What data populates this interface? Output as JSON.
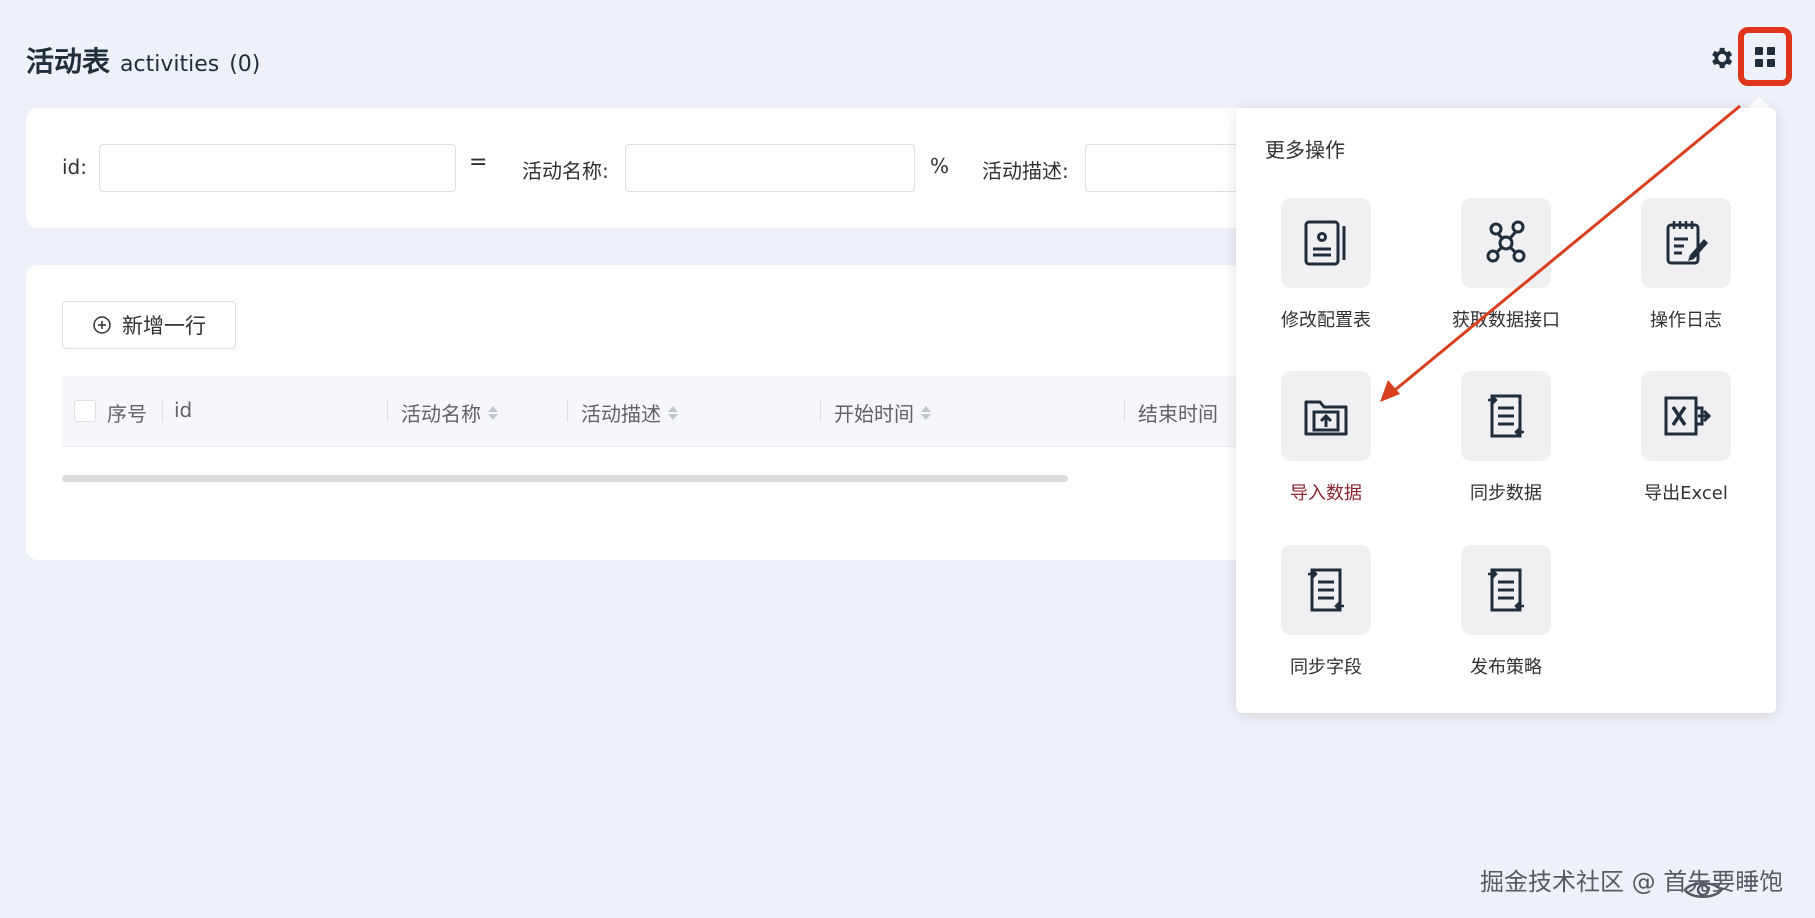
{
  "header": {
    "title": "活动表",
    "subtitle": "activities",
    "count": "(0)"
  },
  "filters": {
    "id_label": "id:",
    "id_operator": "=",
    "name_label": "活动名称:",
    "name_operator": "%",
    "desc_label": "活动描述:"
  },
  "toolbar": {
    "add_row_label": "新增一行"
  },
  "table": {
    "columns": [
      "序号",
      "id",
      "活动名称",
      "活动描述",
      "开始时间",
      "结束时间"
    ]
  },
  "popover": {
    "title": "更多操作",
    "items": [
      {
        "label": "修改配置表",
        "icon": "config-document-icon"
      },
      {
        "label": "获取数据接口",
        "icon": "network-nodes-icon"
      },
      {
        "label": "操作日志",
        "icon": "edit-log-icon"
      },
      {
        "label": "导入数据",
        "icon": "folder-upload-icon",
        "active": true
      },
      {
        "label": "同步数据",
        "icon": "sync-list-icon"
      },
      {
        "label": "导出Excel",
        "icon": "excel-export-icon"
      },
      {
        "label": "同步字段",
        "icon": "sync-list-icon"
      },
      {
        "label": "发布策略",
        "icon": "sync-list-icon"
      }
    ]
  },
  "watermark": "掘金技术社区 @ 首先要睡饱",
  "colors": {
    "page_bg": "#eef1f7",
    "highlight": "#e0351d",
    "icon_dark": "#1f2d3d",
    "active_label": "#8a2432"
  }
}
